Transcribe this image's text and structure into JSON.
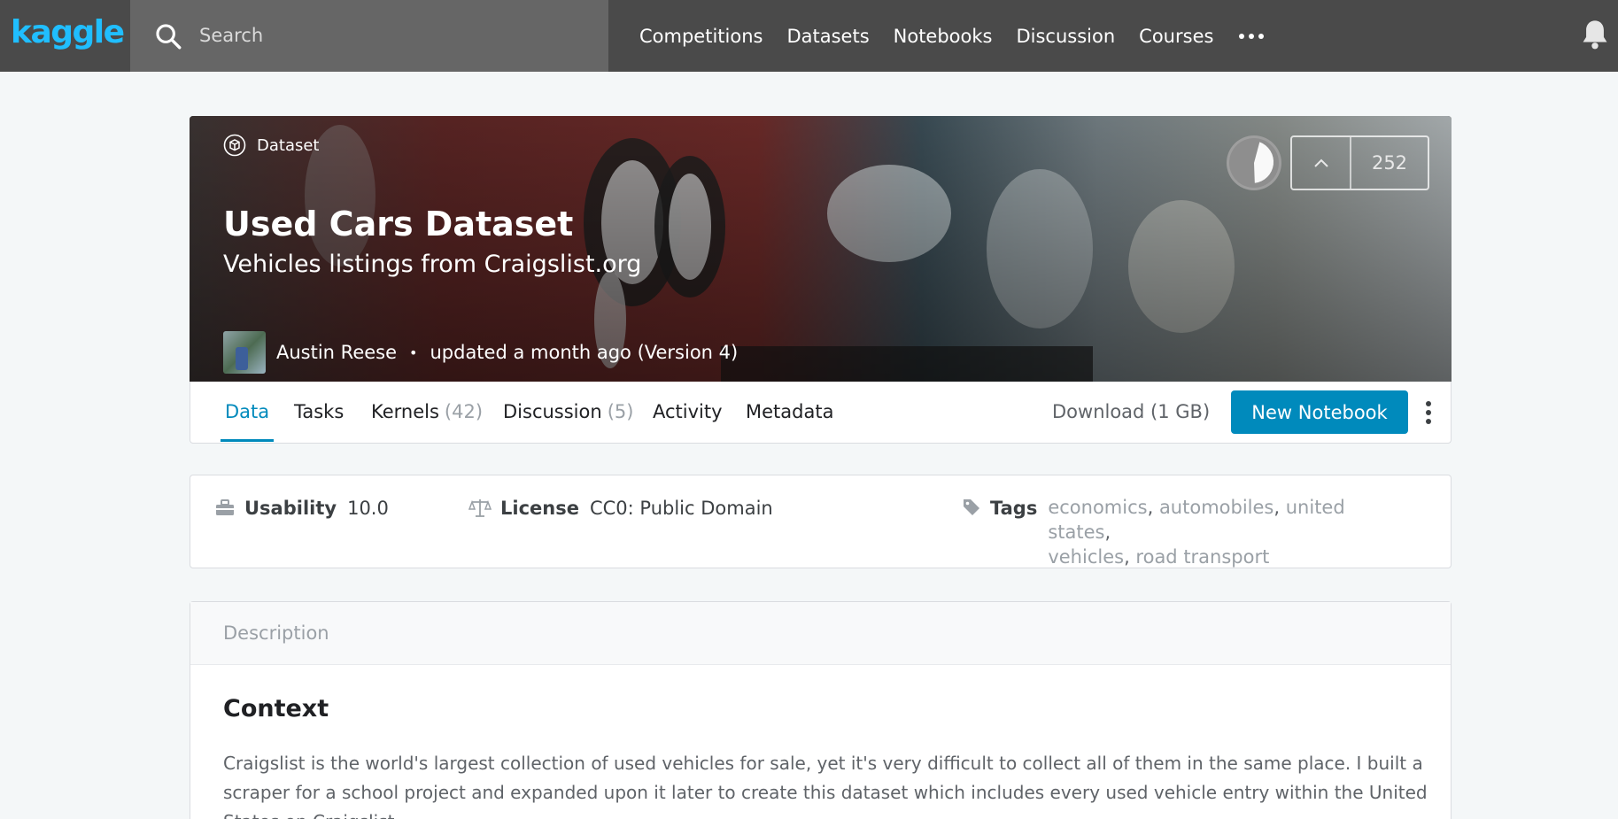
{
  "brand": {
    "logo_text": "kaggle",
    "accent": "#20beff"
  },
  "search": {
    "placeholder": "Search"
  },
  "nav": {
    "items": [
      "Competitions",
      "Datasets",
      "Notebooks",
      "Discussion",
      "Courses"
    ]
  },
  "hero": {
    "type_label": "Dataset",
    "title": "Used Cars Dataset",
    "subtitle": "Vehicles listings from Craigslist.org",
    "author": "Austin Reese",
    "updated": "updated a month ago (Version 4)",
    "votes": "252"
  },
  "tabs": {
    "data": "Data",
    "tasks": "Tasks",
    "kernels": "Kernels",
    "kernels_count": "(42)",
    "discussion": "Discussion",
    "discussion_count": "(5)",
    "activity": "Activity",
    "metadata": "Metadata",
    "download": "Download (1 GB)",
    "new_notebook": "New Notebook",
    "active_color": "#008abc"
  },
  "meta": {
    "usability_label": "Usability",
    "usability_value": "10.0",
    "license_label": "License",
    "license_value": "CC0: Public Domain",
    "tags_label": "Tags",
    "tags": [
      "economics",
      "automobiles",
      "united states",
      "vehicles",
      "road transport"
    ]
  },
  "description": {
    "header": "Description",
    "heading": "Context",
    "body": "Craigslist is the world's largest collection of used vehicles for sale, yet it's very difficult to collect all of them in the same place. I built a scraper for a school project and expanded upon it later to create this dataset which includes every used vehicle entry within the United States on Craigslist."
  }
}
